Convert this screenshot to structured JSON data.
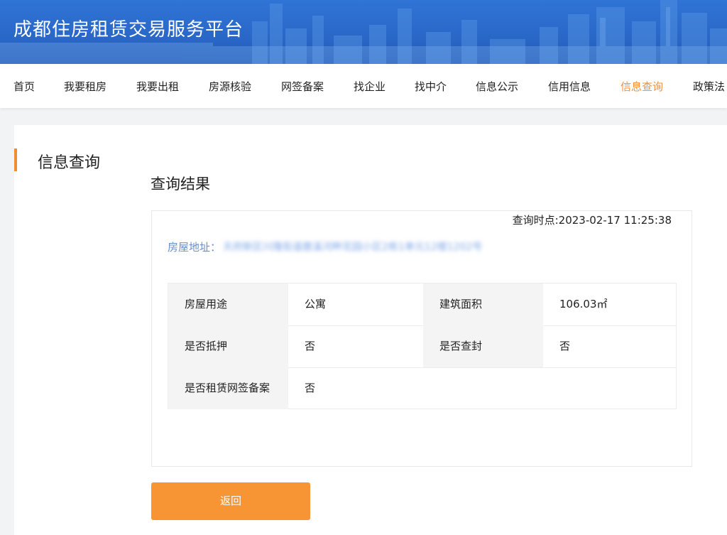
{
  "header": {
    "title": "成都住房租赁交易服务平台",
    "banner_color": "#2a67c7"
  },
  "nav": {
    "items": [
      {
        "label": "首页"
      },
      {
        "label": "我要租房"
      },
      {
        "label": "我要出租"
      },
      {
        "label": "房源核验"
      },
      {
        "label": "网签备案"
      },
      {
        "label": "找企业"
      },
      {
        "label": "找中介"
      },
      {
        "label": "信息公示"
      },
      {
        "label": "信用信息"
      },
      {
        "label": "信息查询",
        "active": true
      },
      {
        "label": "政策法"
      }
    ],
    "active_color": "#f0903a"
  },
  "sidebar": {
    "title": "信息查询",
    "accent_color": "#f08d2f"
  },
  "result": {
    "title": "查询结果",
    "query_time": "查询时点:2023-02-17 11:25:38",
    "address_label": "房屋地址：",
    "address_value": "天府新区兴隆街道鹿溪河畔花园小区2栋1单元12楼1202号",
    "table": {
      "use_label": "房屋用途",
      "use_value": "公寓",
      "area_label": "建筑面积",
      "area_value": "106.03㎡",
      "mortgage_label": "是否抵押",
      "mortgage_value": "否",
      "sealed_label": "是否查封",
      "sealed_value": "否",
      "filing_label": "是否租赁网签备案",
      "filing_value": "否"
    }
  },
  "actions": {
    "back_label": "返回",
    "button_color": "#f79433"
  }
}
